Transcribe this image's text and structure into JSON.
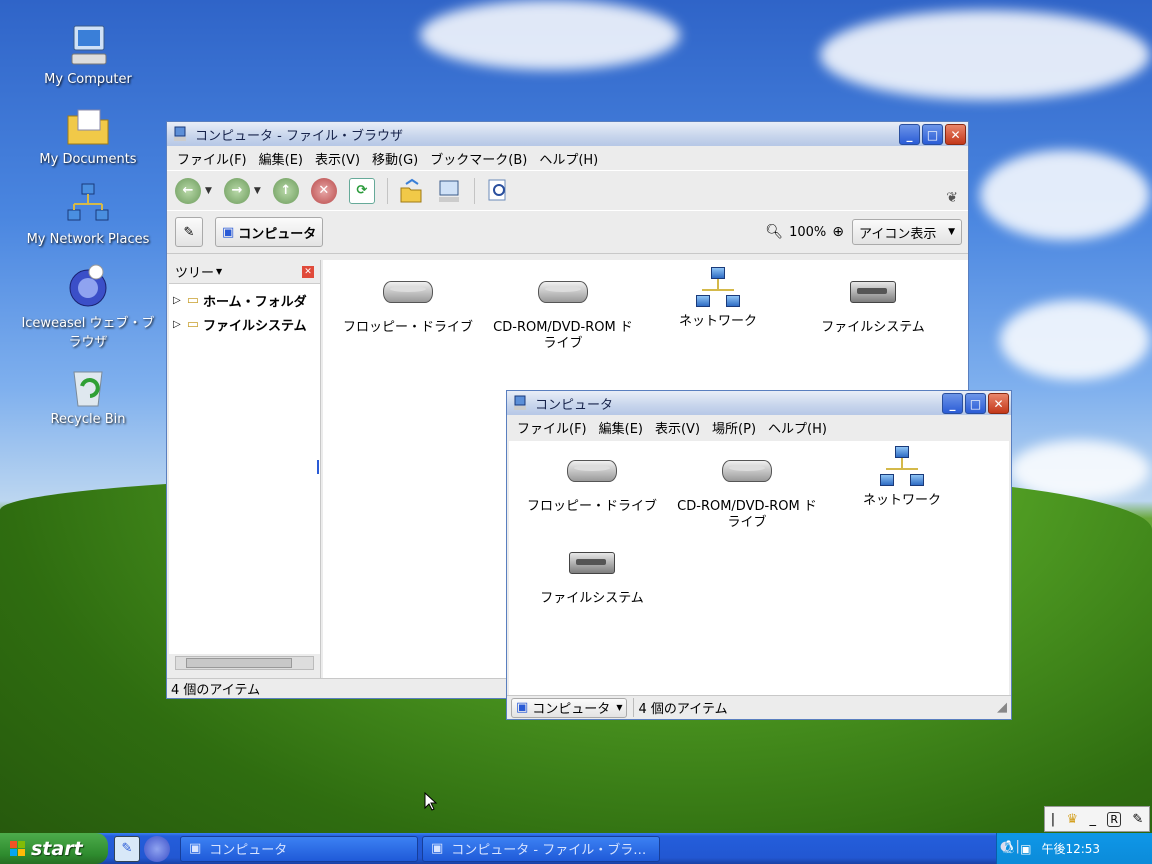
{
  "desktop": {
    "icons": [
      {
        "label": "My Computer"
      },
      {
        "label": "My Documents"
      },
      {
        "label": "My Network Places"
      },
      {
        "label": "Iceweasel ウェブ・ブラウザ"
      },
      {
        "label": "Recycle Bin"
      }
    ]
  },
  "browser": {
    "title": "コンピュータ - ファイル・ブラウザ",
    "menu": [
      "ファイル(F)",
      "編集(E)",
      "表示(V)",
      "移動(G)",
      "ブックマーク(B)",
      "ヘルプ(H)"
    ],
    "location_button": "コンピュータ",
    "zoom": "100%",
    "view_mode": "アイコン表示",
    "sidebar_title": "ツリー",
    "tree": [
      "ホーム・フォルダ",
      "ファイルシステム"
    ],
    "items": [
      "フロッピー・ドライブ",
      "CD-ROM/DVD-ROM ドライブ",
      "ネットワーク",
      "ファイルシステム"
    ],
    "status": "4 個のアイテム"
  },
  "spatial": {
    "title": "コンピュータ",
    "menu": [
      "ファイル(F)",
      "編集(E)",
      "表示(V)",
      "場所(P)",
      "ヘルプ(H)"
    ],
    "items": [
      "フロッピー・ドライブ",
      "CD-ROM/DVD-ROM ドライブ",
      "ネットワーク",
      "ファイルシステム"
    ],
    "location": "コンピュータ",
    "status": "4 個のアイテム"
  },
  "taskbar": {
    "start": "start",
    "tasks": [
      "コンピュータ",
      "コンピュータ - ファイル・ブラ…"
    ],
    "clock": "午後12:53"
  }
}
